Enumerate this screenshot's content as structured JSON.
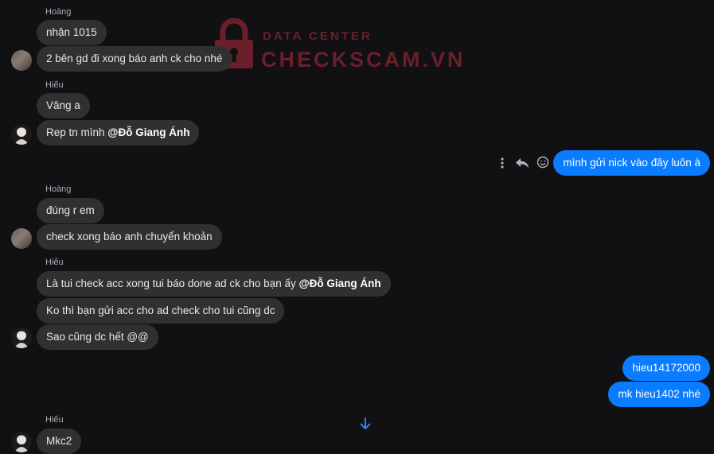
{
  "watermark": {
    "line1": "DATA CENTER",
    "line2": "CHECKSCAM.VN"
  },
  "groups": [
    {
      "sender": "Hoàng",
      "messages": [
        "nhận 1015",
        "2 bên gd đi xong báo anh ck cho nhé"
      ]
    },
    {
      "sender": "Hiếu",
      "messages": [
        "Vâng a"
      ],
      "mention_msg": {
        "text": "Rep tn mình ",
        "mention": "@Đỗ Giang Ánh"
      }
    },
    {
      "sender": "Hoàng",
      "messages": [
        "đúng r em",
        "check xong báo anh chuyển khoản"
      ]
    },
    {
      "sender": "Hiếu",
      "mention_msg": {
        "text": "Là tui check acc xong tui báo done ad ck cho bạn ấy ",
        "mention": "@Đỗ Giang Ánh"
      },
      "messages": [
        "Ko thì bạn gửi acc cho ad check cho tui cũng dc",
        "Sao cũng dc hết @@"
      ]
    },
    {
      "sender": "Hiếu",
      "messages": [
        "Mkc2"
      ]
    }
  ],
  "outgoing": [
    "mình gửi nick vào đây luôn à",
    "hieu14172000",
    "mk hieu1402 nhé"
  ],
  "icons": {
    "more": "more-vertical-icon",
    "reply": "reply-icon",
    "react": "smiley-icon",
    "scroll": "arrow-down-icon"
  }
}
